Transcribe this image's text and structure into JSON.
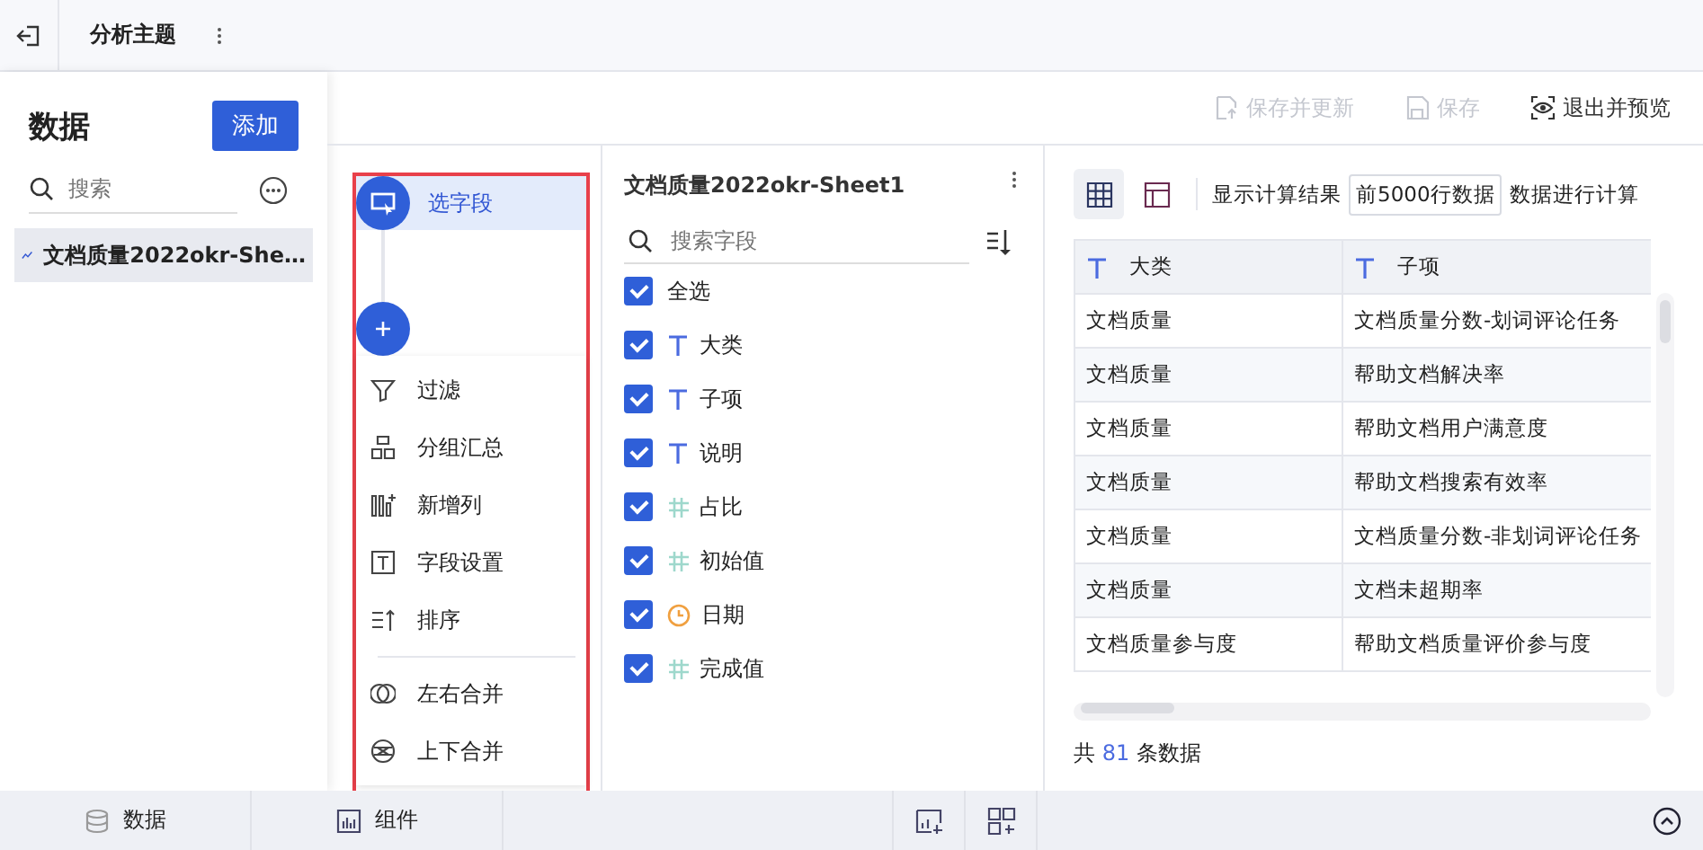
{
  "topbar": {
    "title": "分析主题"
  },
  "toolbar": {
    "buttons": [
      {
        "label": "保存并更新",
        "kind": "update",
        "disabled": true
      },
      {
        "label": "保存",
        "kind": "save",
        "disabled": true
      },
      {
        "label": "退出并预览",
        "kind": "preview",
        "disabled": false
      }
    ]
  },
  "data_panel": {
    "title": "数据",
    "add_button": "添加",
    "search": {
      "placeholder": "搜索"
    },
    "items": [
      {
        "label": "文档质量2022okr-She…",
        "selected": true
      }
    ]
  },
  "steps": {
    "current": {
      "label": "选字段",
      "selected": true
    },
    "menu": [
      {
        "label": "过滤",
        "kind": "filter"
      },
      {
        "label": "分组汇总",
        "kind": "group"
      },
      {
        "label": "新增列",
        "kind": "addcol"
      },
      {
        "label": "字段设置",
        "kind": "fieldset"
      },
      {
        "label": "排序",
        "kind": "sort"
      },
      {
        "label": "左右合并",
        "kind": "hmerge"
      },
      {
        "label": "上下合并",
        "kind": "vmerge"
      }
    ]
  },
  "fields": {
    "title": "文档质量2022okr-Sheet1",
    "search": {
      "placeholder": "搜索字段"
    },
    "select_all": {
      "label": "全选",
      "checked": true
    },
    "items": [
      {
        "label": "大类",
        "kind": "text",
        "checked": true
      },
      {
        "label": "子项",
        "kind": "text",
        "checked": true
      },
      {
        "label": "说明",
        "kind": "text",
        "checked": true
      },
      {
        "label": "占比",
        "kind": "number",
        "checked": true
      },
      {
        "label": "初始值",
        "kind": "number",
        "checked": true
      },
      {
        "label": "日期",
        "kind": "date",
        "checked": true
      },
      {
        "label": "完成值",
        "kind": "number",
        "checked": true
      }
    ]
  },
  "preview": {
    "views": [
      {
        "kind": "grid",
        "selected": true
      },
      {
        "kind": "layout",
        "selected": false
      }
    ],
    "label_before": "显示计算结果",
    "select_value": "前5000行数据",
    "label_after": "数据进行计算",
    "table": {
      "columns": [
        "大类",
        "子项"
      ],
      "rows": [
        [
          "文档质量",
          "文档质量分数-划词评论任务"
        ],
        [
          "文档质量",
          "帮助文档解决率"
        ],
        [
          "文档质量",
          "帮助文档用户满意度"
        ],
        [
          "文档质量",
          "帮助文档搜索有效率"
        ],
        [
          "文档质量",
          "文档质量分数-非划词评论任务"
        ],
        [
          "文档质量",
          "文档未超期率"
        ],
        [
          "文档质量参与度",
          "帮助文档质量评价参与度"
        ]
      ]
    },
    "summary": {
      "prefix": "共",
      "count": "81",
      "suffix": "条数据"
    }
  },
  "bottom_bar": {
    "tabs": [
      {
        "label": "数据",
        "kind": "data"
      },
      {
        "label": "组件",
        "kind": "chart"
      }
    ]
  }
}
